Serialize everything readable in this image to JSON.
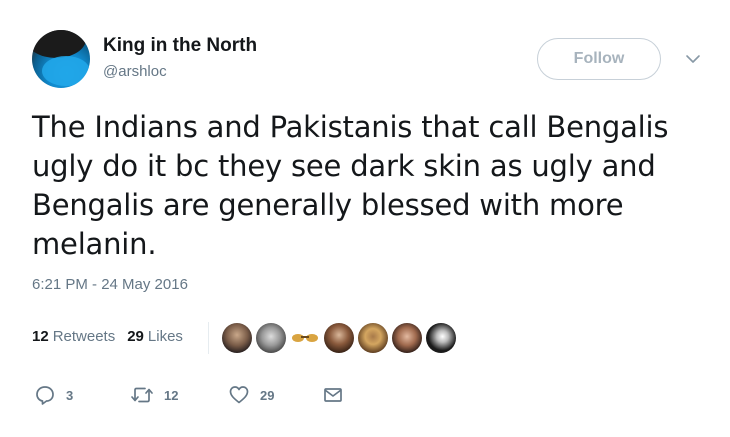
{
  "user": {
    "display_name": "King in the North",
    "handle": "@arshloc",
    "avatar_icon": "profile-avatar"
  },
  "follow_button": {
    "label": "Follow"
  },
  "tweet": {
    "text": "The Indians and Pakistanis that call Bengalis ugly do it bc they see dark skin as ugly and Bengalis are generally blessed with more melanin.",
    "timestamp": "6:21 PM - 24 May 2016"
  },
  "stats": {
    "retweets_count": "12",
    "retweets_label": "Retweets",
    "likes_count": "29",
    "likes_label": "Likes"
  },
  "liker_avatars": [
    {
      "icon": "liker-avatar"
    },
    {
      "icon": "liker-avatar"
    },
    {
      "icon": "liker-avatar"
    },
    {
      "icon": "liker-avatar"
    },
    {
      "icon": "liker-avatar"
    },
    {
      "icon": "liker-avatar"
    },
    {
      "icon": "liker-avatar"
    }
  ],
  "actions": {
    "reply_count": "3",
    "retweet_count": "12",
    "like_count": "29"
  },
  "colors": {
    "text_primary": "#14171a",
    "text_secondary": "#657786",
    "follow_border": "#c7d0d8",
    "follow_text": "#a7b3bd"
  }
}
